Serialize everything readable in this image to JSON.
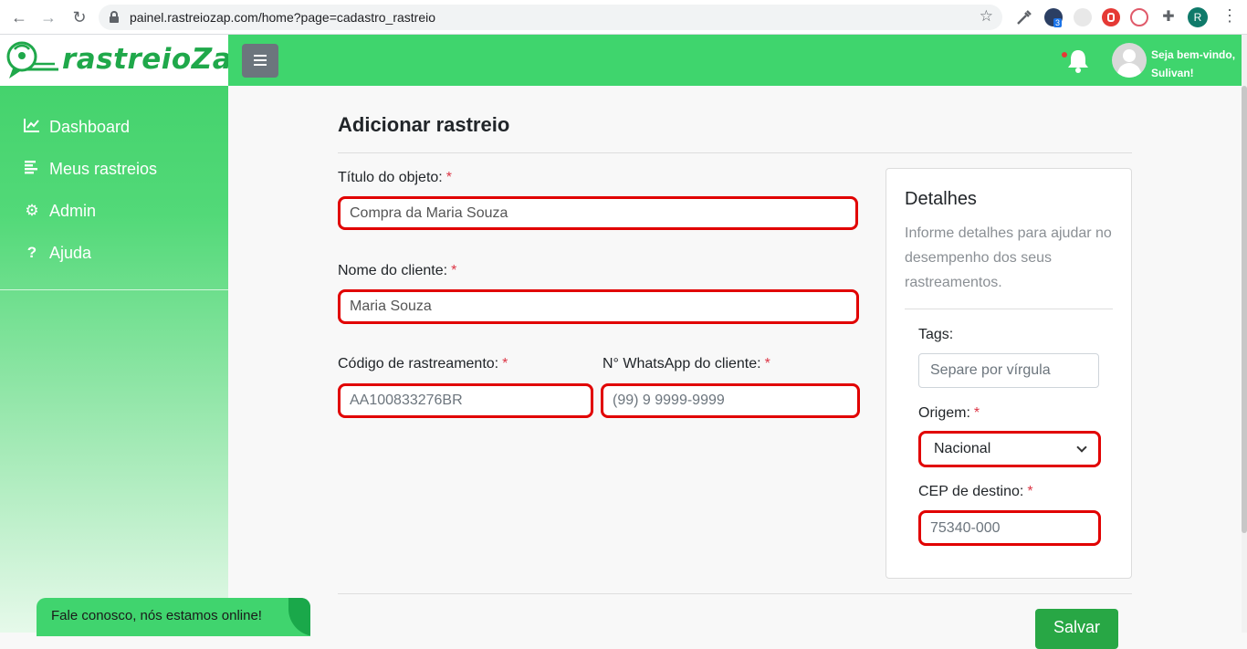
{
  "browser": {
    "url": "painel.rastreiozap.com/home?page=cadastro_rastreio",
    "profile_initial": "R",
    "extension_badge": "3"
  },
  "brand": {
    "name": "rastreioZap",
    "color": "#1fa84a"
  },
  "sidebar": {
    "items": [
      {
        "label": "Dashboard",
        "icon": "chart-line-icon"
      },
      {
        "label": "Meus rastreios",
        "icon": "list-icon"
      },
      {
        "label": "Admin",
        "icon": "gears-icon"
      },
      {
        "label": "Ajuda",
        "icon": "question-icon"
      }
    ]
  },
  "topbar": {
    "welcome": "Seja bem-vindo, Sulivan!",
    "accent": "#3fd56d"
  },
  "form": {
    "title": "Adicionar rastreio",
    "required_mark": "*",
    "object_title": {
      "label": "Título do objeto:",
      "value": "Compra da Maria Souza"
    },
    "client_name": {
      "label": "Nome do cliente:",
      "value": "Maria Souza"
    },
    "tracking_code": {
      "label": "Código de rastreamento:",
      "placeholder": "AA100833276BR"
    },
    "whatsapp": {
      "label": "N° WhatsApp do cliente:",
      "placeholder": "(99) 9 9999-9999"
    },
    "save_label": "Salvar"
  },
  "details": {
    "title": "Detalhes",
    "description": "Informe detalhes para ajudar no desempenho dos seus rastreamentos.",
    "tags": {
      "label": "Tags:",
      "placeholder": "Separe por vírgula"
    },
    "origin": {
      "label": "Origem:",
      "value": "Nacional"
    },
    "cep": {
      "label": "CEP de destino:",
      "placeholder": "75340-000"
    }
  },
  "chat": {
    "text": "Fale conosco, nós estamos online!"
  },
  "colors": {
    "highlight_border": "#e10000",
    "required": "#dc3545",
    "save": "#28a745"
  }
}
